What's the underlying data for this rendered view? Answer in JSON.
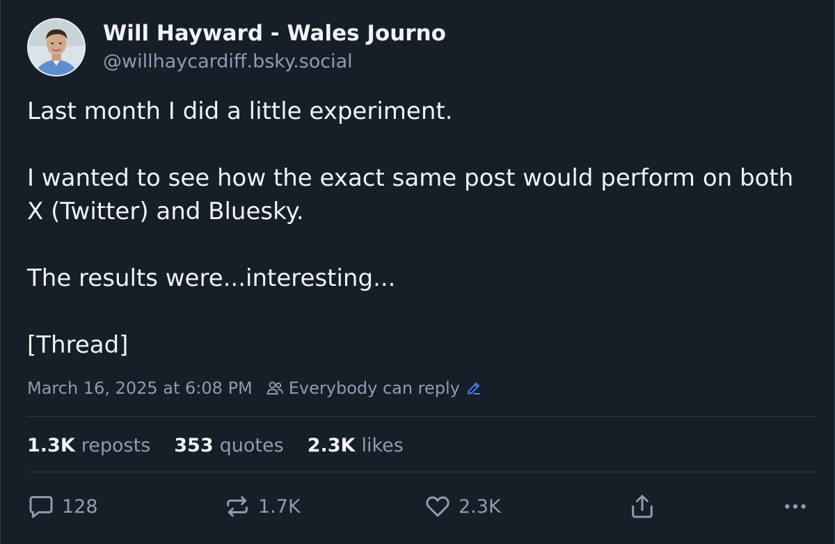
{
  "author": {
    "display_name": "Will Hayward - Wales Journo",
    "handle": "@willhaycardiff.bsky.social",
    "avatar": "avatar-photo"
  },
  "post": {
    "paragraphs": [
      "Last month I did a little experiment.",
      "I wanted to see how the exact same post would perform on both X (Twitter) and Bluesky.",
      "The results were...interesting...",
      "[Thread]"
    ]
  },
  "meta": {
    "timestamp": "March 16, 2025 at 6:08 PM",
    "reply_setting": "Everybody can reply",
    "reply_icon": "people-icon",
    "edit_icon": "pencil-icon"
  },
  "stats": {
    "reposts_count": "1.3K",
    "reposts_label": "reposts",
    "quotes_count": "353",
    "quotes_label": "quotes",
    "likes_count": "2.3K",
    "likes_label": "likes"
  },
  "actions": {
    "reply_count": "128",
    "repost_count": "1.7K",
    "like_count": "2.3K",
    "reply_icon": "reply-bubble-icon",
    "repost_icon": "repost-icon",
    "like_icon": "heart-icon",
    "share_icon": "share-icon",
    "more_icon": "more-dots-icon"
  },
  "colors": {
    "background": "#161e27",
    "text_primary": "#f1f3f5",
    "text_secondary": "#8c9eb2",
    "accent": "#3d8af7",
    "divider": "#2e3d4d"
  }
}
